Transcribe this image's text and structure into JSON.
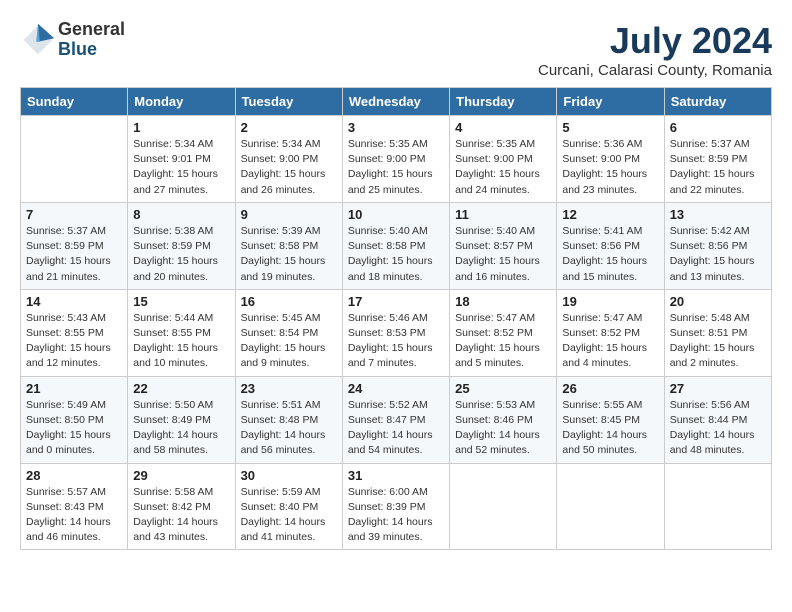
{
  "logo": {
    "general": "General",
    "blue": "Blue"
  },
  "title": "July 2024",
  "subtitle": "Curcani, Calarasi County, Romania",
  "weekdays": [
    "Sunday",
    "Monday",
    "Tuesday",
    "Wednesday",
    "Thursday",
    "Friday",
    "Saturday"
  ],
  "weeks": [
    [
      {
        "day": "",
        "info": ""
      },
      {
        "day": "1",
        "info": "Sunrise: 5:34 AM\nSunset: 9:01 PM\nDaylight: 15 hours\nand 27 minutes."
      },
      {
        "day": "2",
        "info": "Sunrise: 5:34 AM\nSunset: 9:00 PM\nDaylight: 15 hours\nand 26 minutes."
      },
      {
        "day": "3",
        "info": "Sunrise: 5:35 AM\nSunset: 9:00 PM\nDaylight: 15 hours\nand 25 minutes."
      },
      {
        "day": "4",
        "info": "Sunrise: 5:35 AM\nSunset: 9:00 PM\nDaylight: 15 hours\nand 24 minutes."
      },
      {
        "day": "5",
        "info": "Sunrise: 5:36 AM\nSunset: 9:00 PM\nDaylight: 15 hours\nand 23 minutes."
      },
      {
        "day": "6",
        "info": "Sunrise: 5:37 AM\nSunset: 8:59 PM\nDaylight: 15 hours\nand 22 minutes."
      }
    ],
    [
      {
        "day": "7",
        "info": "Sunrise: 5:37 AM\nSunset: 8:59 PM\nDaylight: 15 hours\nand 21 minutes."
      },
      {
        "day": "8",
        "info": "Sunrise: 5:38 AM\nSunset: 8:59 PM\nDaylight: 15 hours\nand 20 minutes."
      },
      {
        "day": "9",
        "info": "Sunrise: 5:39 AM\nSunset: 8:58 PM\nDaylight: 15 hours\nand 19 minutes."
      },
      {
        "day": "10",
        "info": "Sunrise: 5:40 AM\nSunset: 8:58 PM\nDaylight: 15 hours\nand 18 minutes."
      },
      {
        "day": "11",
        "info": "Sunrise: 5:40 AM\nSunset: 8:57 PM\nDaylight: 15 hours\nand 16 minutes."
      },
      {
        "day": "12",
        "info": "Sunrise: 5:41 AM\nSunset: 8:56 PM\nDaylight: 15 hours\nand 15 minutes."
      },
      {
        "day": "13",
        "info": "Sunrise: 5:42 AM\nSunset: 8:56 PM\nDaylight: 15 hours\nand 13 minutes."
      }
    ],
    [
      {
        "day": "14",
        "info": "Sunrise: 5:43 AM\nSunset: 8:55 PM\nDaylight: 15 hours\nand 12 minutes."
      },
      {
        "day": "15",
        "info": "Sunrise: 5:44 AM\nSunset: 8:55 PM\nDaylight: 15 hours\nand 10 minutes."
      },
      {
        "day": "16",
        "info": "Sunrise: 5:45 AM\nSunset: 8:54 PM\nDaylight: 15 hours\nand 9 minutes."
      },
      {
        "day": "17",
        "info": "Sunrise: 5:46 AM\nSunset: 8:53 PM\nDaylight: 15 hours\nand 7 minutes."
      },
      {
        "day": "18",
        "info": "Sunrise: 5:47 AM\nSunset: 8:52 PM\nDaylight: 15 hours\nand 5 minutes."
      },
      {
        "day": "19",
        "info": "Sunrise: 5:47 AM\nSunset: 8:52 PM\nDaylight: 15 hours\nand 4 minutes."
      },
      {
        "day": "20",
        "info": "Sunrise: 5:48 AM\nSunset: 8:51 PM\nDaylight: 15 hours\nand 2 minutes."
      }
    ],
    [
      {
        "day": "21",
        "info": "Sunrise: 5:49 AM\nSunset: 8:50 PM\nDaylight: 15 hours\nand 0 minutes."
      },
      {
        "day": "22",
        "info": "Sunrise: 5:50 AM\nSunset: 8:49 PM\nDaylight: 14 hours\nand 58 minutes."
      },
      {
        "day": "23",
        "info": "Sunrise: 5:51 AM\nSunset: 8:48 PM\nDaylight: 14 hours\nand 56 minutes."
      },
      {
        "day": "24",
        "info": "Sunrise: 5:52 AM\nSunset: 8:47 PM\nDaylight: 14 hours\nand 54 minutes."
      },
      {
        "day": "25",
        "info": "Sunrise: 5:53 AM\nSunset: 8:46 PM\nDaylight: 14 hours\nand 52 minutes."
      },
      {
        "day": "26",
        "info": "Sunrise: 5:55 AM\nSunset: 8:45 PM\nDaylight: 14 hours\nand 50 minutes."
      },
      {
        "day": "27",
        "info": "Sunrise: 5:56 AM\nSunset: 8:44 PM\nDaylight: 14 hours\nand 48 minutes."
      }
    ],
    [
      {
        "day": "28",
        "info": "Sunrise: 5:57 AM\nSunset: 8:43 PM\nDaylight: 14 hours\nand 46 minutes."
      },
      {
        "day": "29",
        "info": "Sunrise: 5:58 AM\nSunset: 8:42 PM\nDaylight: 14 hours\nand 43 minutes."
      },
      {
        "day": "30",
        "info": "Sunrise: 5:59 AM\nSunset: 8:40 PM\nDaylight: 14 hours\nand 41 minutes."
      },
      {
        "day": "31",
        "info": "Sunrise: 6:00 AM\nSunset: 8:39 PM\nDaylight: 14 hours\nand 39 minutes."
      },
      {
        "day": "",
        "info": ""
      },
      {
        "day": "",
        "info": ""
      },
      {
        "day": "",
        "info": ""
      }
    ]
  ]
}
